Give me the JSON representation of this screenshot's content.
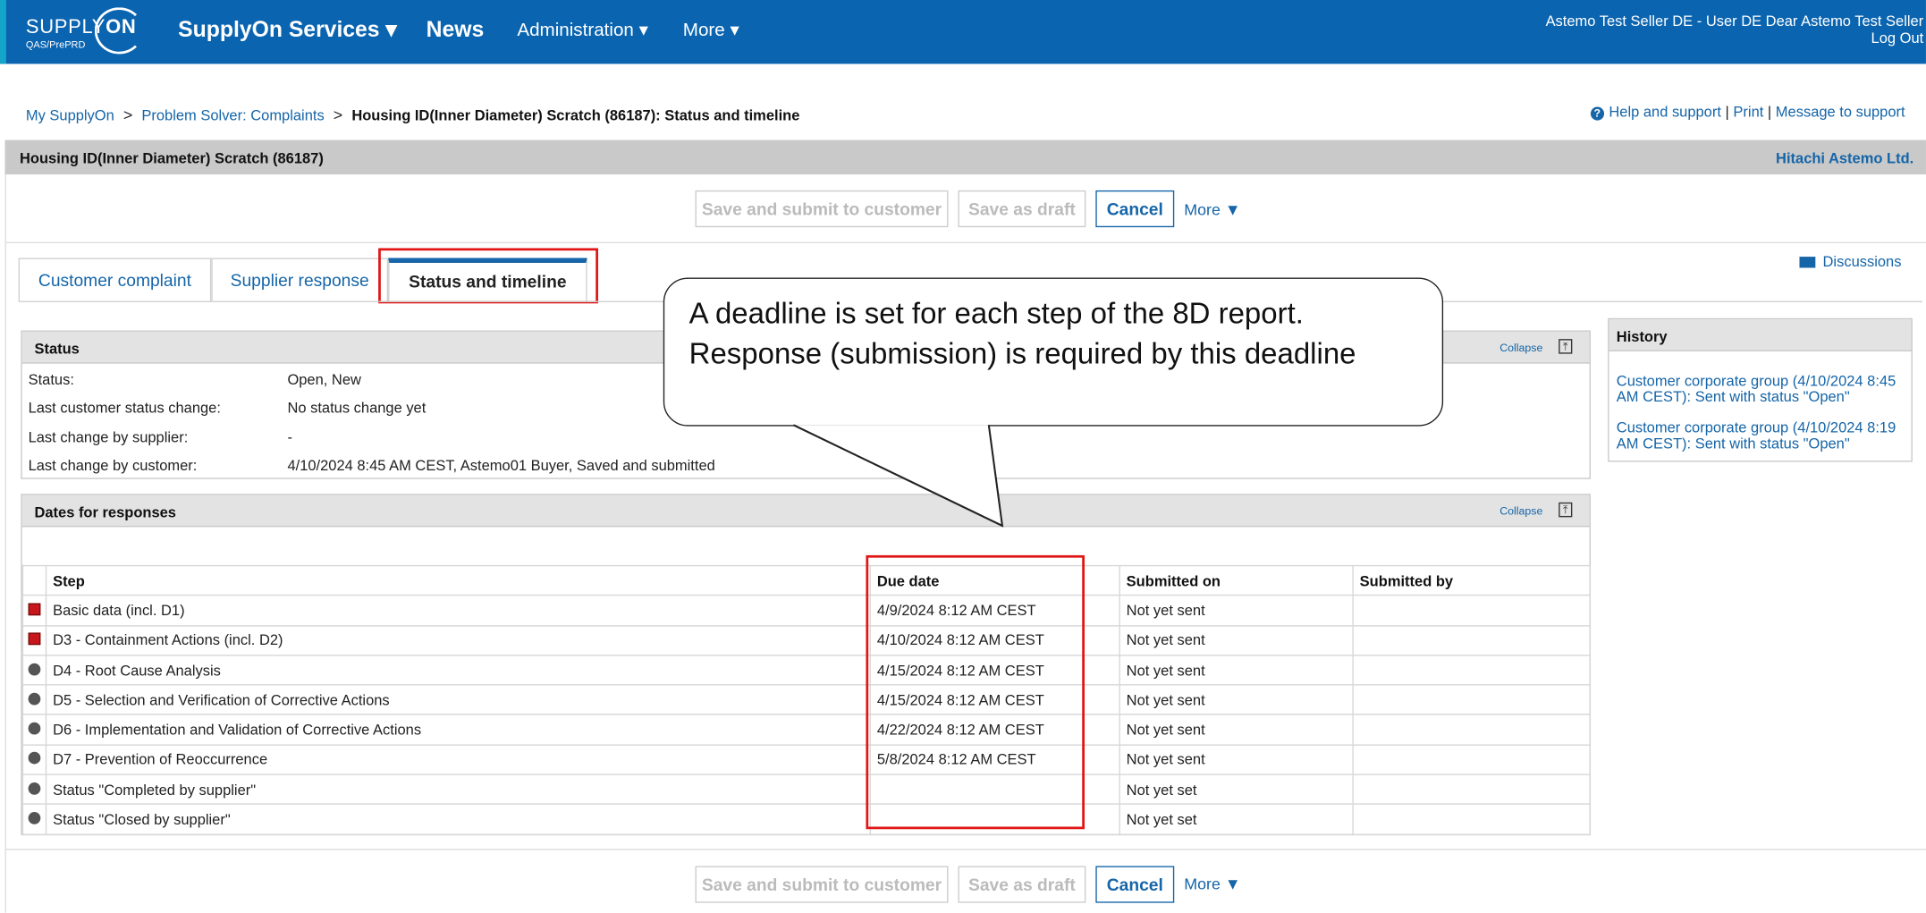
{
  "topbar": {
    "logo_main": "SUPPLY",
    "logo_on": "ON",
    "logo_sub": "QAS/PrePRD",
    "nav_services": "SupplyOn Services ▾",
    "nav_news": "News",
    "nav_admin": "Administration ▾",
    "nav_more": "More ▾",
    "user_line": "Astemo Test Seller DE - User DE Dear Astemo Test Seller",
    "logout": "Log Out"
  },
  "breadcrumb": {
    "home": "My SupplyOn",
    "sep": ">",
    "section": "Problem Solver: Complaints",
    "current": "Housing ID(Inner Diameter) Scratch (86187): Status and timeline"
  },
  "help": {
    "help_support": "Help and support",
    "print": "Print",
    "message": "Message to support",
    "bar": "|",
    "q": "?"
  },
  "header": {
    "title": "Housing ID(Inner Diameter) Scratch (86187)",
    "company": "Hitachi Astemo Ltd."
  },
  "actions": {
    "submit": "Save and submit to customer",
    "draft": "Save as draft",
    "cancel": "Cancel",
    "more": "More ▼"
  },
  "tabs": {
    "complaint": "Customer complaint",
    "response": "Supplier response",
    "status": "Status and timeline"
  },
  "discussions": "Discussions",
  "status_panel": {
    "title": "Status",
    "collapse": "Collapse",
    "collapse_icon": "⤒",
    "rows": [
      {
        "label": "Status:",
        "value": "Open, New"
      },
      {
        "label": "Last customer status change:",
        "value": "No status change yet"
      },
      {
        "label": "Last change by supplier:",
        "value": "-"
      },
      {
        "label": "Last change by customer:",
        "value": "4/10/2024 8:45 AM CEST, Astemo01 Buyer, Saved and submitted"
      }
    ]
  },
  "dates_panel": {
    "title": "Dates for responses",
    "collapse": "Collapse",
    "headers": {
      "step": "Step",
      "due": "Due date",
      "submitted_on": "Submitted on",
      "submitted_by": "Submitted by"
    },
    "rows": [
      {
        "ind": "red",
        "step": "Basic data (incl. D1)",
        "due": "4/9/2024 8:12 AM CEST",
        "on": "Not yet sent",
        "by": ""
      },
      {
        "ind": "red",
        "step": "D3 - Containment Actions (incl. D2)",
        "due": "4/10/2024 8:12 AM CEST",
        "on": "Not yet sent",
        "by": ""
      },
      {
        "ind": "gray",
        "step": "D4 - Root Cause Analysis",
        "due": "4/15/2024 8:12 AM CEST",
        "on": "Not yet sent",
        "by": ""
      },
      {
        "ind": "gray",
        "step": "D5 - Selection and Verification of Corrective Actions",
        "due": "4/15/2024 8:12 AM CEST",
        "on": "Not yet sent",
        "by": ""
      },
      {
        "ind": "gray",
        "step": "D6 - Implementation and Validation of Corrective Actions",
        "due": "4/22/2024 8:12 AM CEST",
        "on": "Not yet sent",
        "by": ""
      },
      {
        "ind": "gray",
        "step": "D7 - Prevention of Reoccurrence",
        "due": "5/8/2024 8:12 AM CEST",
        "on": "Not yet sent",
        "by": ""
      },
      {
        "ind": "gray",
        "step": "Status \"Completed by supplier\"",
        "due": "",
        "on": "Not yet set",
        "by": ""
      },
      {
        "ind": "gray",
        "step": "Status \"Closed by supplier\"",
        "due": "",
        "on": "Not yet set",
        "by": ""
      }
    ]
  },
  "history": {
    "title": "History",
    "entries": [
      "Customer corporate group (4/10/2024 8:45 AM CEST): Sent with status \"Open\"",
      "Customer corporate group (4/10/2024 8:19 AM CEST): Sent with status \"Open\""
    ]
  },
  "callout": {
    "text": "A deadline is set for each step of the 8D report. Response (submission) is required by this deadline"
  },
  "colors": {
    "brand": "#0a64b0",
    "accent": "#14a5c9",
    "highlight": "#e01616",
    "link": "#1565a8"
  }
}
